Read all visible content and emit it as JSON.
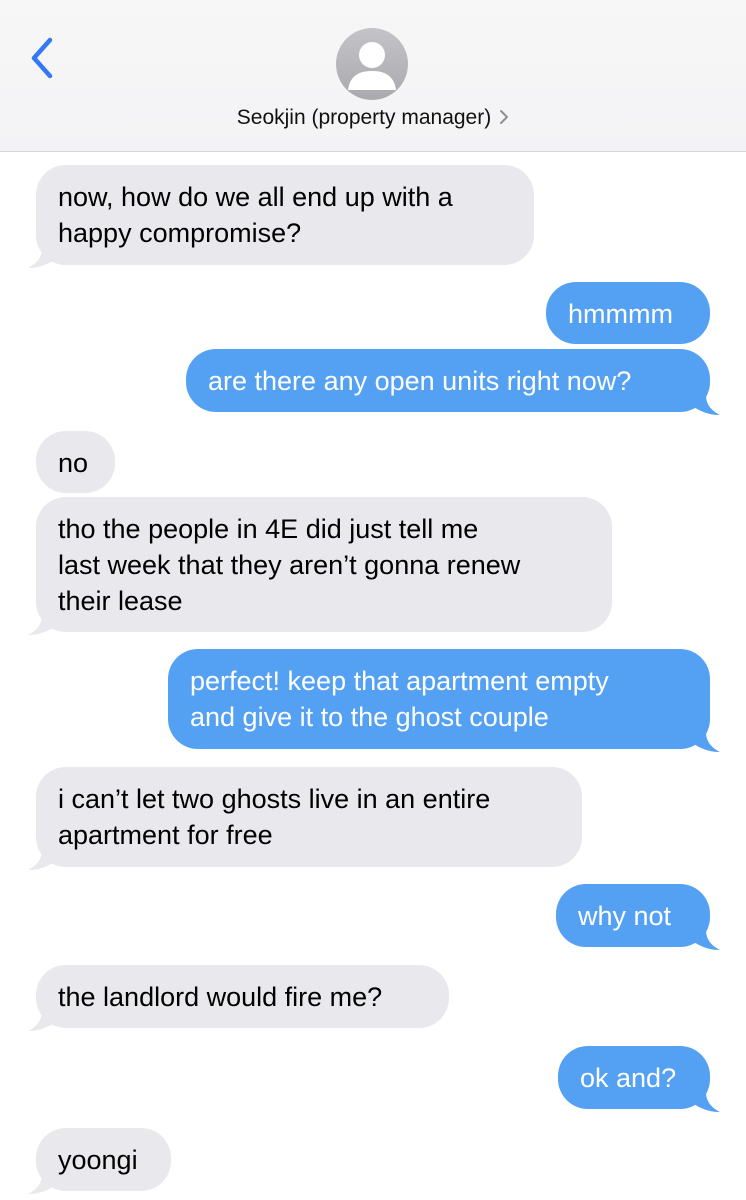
{
  "header": {
    "contact_name": "Seokjin (property manager)",
    "back_icon": "chevron-left-icon",
    "avatar_icon": "person-silhouette-icon",
    "disclosure_icon": "chevron-right-icon"
  },
  "colors": {
    "incoming_bubble": "#e8e8ed",
    "outgoing_bubble": "#54a1f4",
    "accent": "#3478f6"
  },
  "messages": [
    {
      "sender": "contact",
      "text": "now, how do we all end up with a\nhappy compromise?"
    },
    {
      "sender": "me",
      "text": "hmmmm"
    },
    {
      "sender": "me",
      "text": "are there any open units right now?"
    },
    {
      "sender": "contact",
      "text": "no"
    },
    {
      "sender": "contact",
      "text": "tho the people in 4E did just tell me\nlast week that they aren’t gonna renew\ntheir lease"
    },
    {
      "sender": "me",
      "text": "perfect! keep that apartment empty\nand give it to the ghost couple"
    },
    {
      "sender": "contact",
      "text": "i can’t let two ghosts live in an entire\napartment for free"
    },
    {
      "sender": "me",
      "text": "why not"
    },
    {
      "sender": "contact",
      "text": "the landlord would fire me?"
    },
    {
      "sender": "me",
      "text": "ok and?"
    },
    {
      "sender": "contact",
      "text": "yoongi"
    }
  ]
}
